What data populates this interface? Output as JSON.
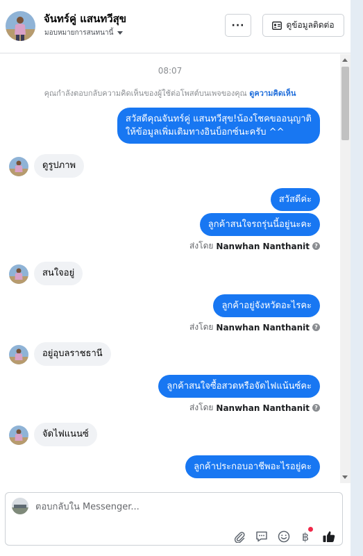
{
  "header": {
    "name": "จันทร์คู่ แสนทวีสุข",
    "assign_label": "มอบหมายการสนทนานี้",
    "more_label": "···",
    "contact_button_label": "ดูข้อมูลติดต่อ"
  },
  "conversation": {
    "timestamp": "08:07",
    "system_note": "คุณกำลังตอบกลับความคิดเห็นของผู้ใช้ต่อโพสต์บนเพจของคุณ",
    "system_note_link": "ดูความคิดเห็น",
    "greeting_line1": "สวัสดีคุณจันทร์คู่ แสนทวีสุข!น้องโชคขออนุญาติ",
    "greeting_line2": "ให้ข้อมูลเพิ่มเติมทางอินบ็อกซ์นะครับ ^^",
    "sent_by_prefix": "ส่งโดย",
    "sender_name": "Nanwhan Nanthanit",
    "messages": [
      {
        "from": "customer",
        "text": "ดูรูปภาพ"
      },
      {
        "from": "page",
        "text": "สวัสดีค่ะ"
      },
      {
        "from": "page",
        "text": "ลูกค้าสนใจรถรุ่นนี้อยู่นะคะ"
      },
      {
        "from": "customer",
        "text": "สนใจอยู่"
      },
      {
        "from": "page",
        "text": "ลูกค้าอยู่จังหวัดอะไรคะ"
      },
      {
        "from": "customer",
        "text": "อยู่อุบลราชธานี"
      },
      {
        "from": "page",
        "text": "ลูกค้าสนใจซื้อสวดหรือจัดไฟแน้นซ์คะ"
      },
      {
        "from": "customer",
        "text": "จัดไฟแนนซ์"
      },
      {
        "from": "page",
        "text": "ลูกค้าประกอบอาชีพอะไรอยู่คะ"
      }
    ]
  },
  "composer": {
    "placeholder": "ตอบกลับใน Messenger...",
    "value": "",
    "tools": [
      "attachment-icon",
      "saved-reply-icon",
      "emoji-icon",
      "baht-payment-icon",
      "thumbs-up-icon"
    ],
    "baht_symbol": "฿"
  },
  "colors": {
    "accent": "#1877f2",
    "incoming_bubble": "#f0f2f5",
    "link": "#216fdb",
    "notification_dot": "#f02849"
  }
}
